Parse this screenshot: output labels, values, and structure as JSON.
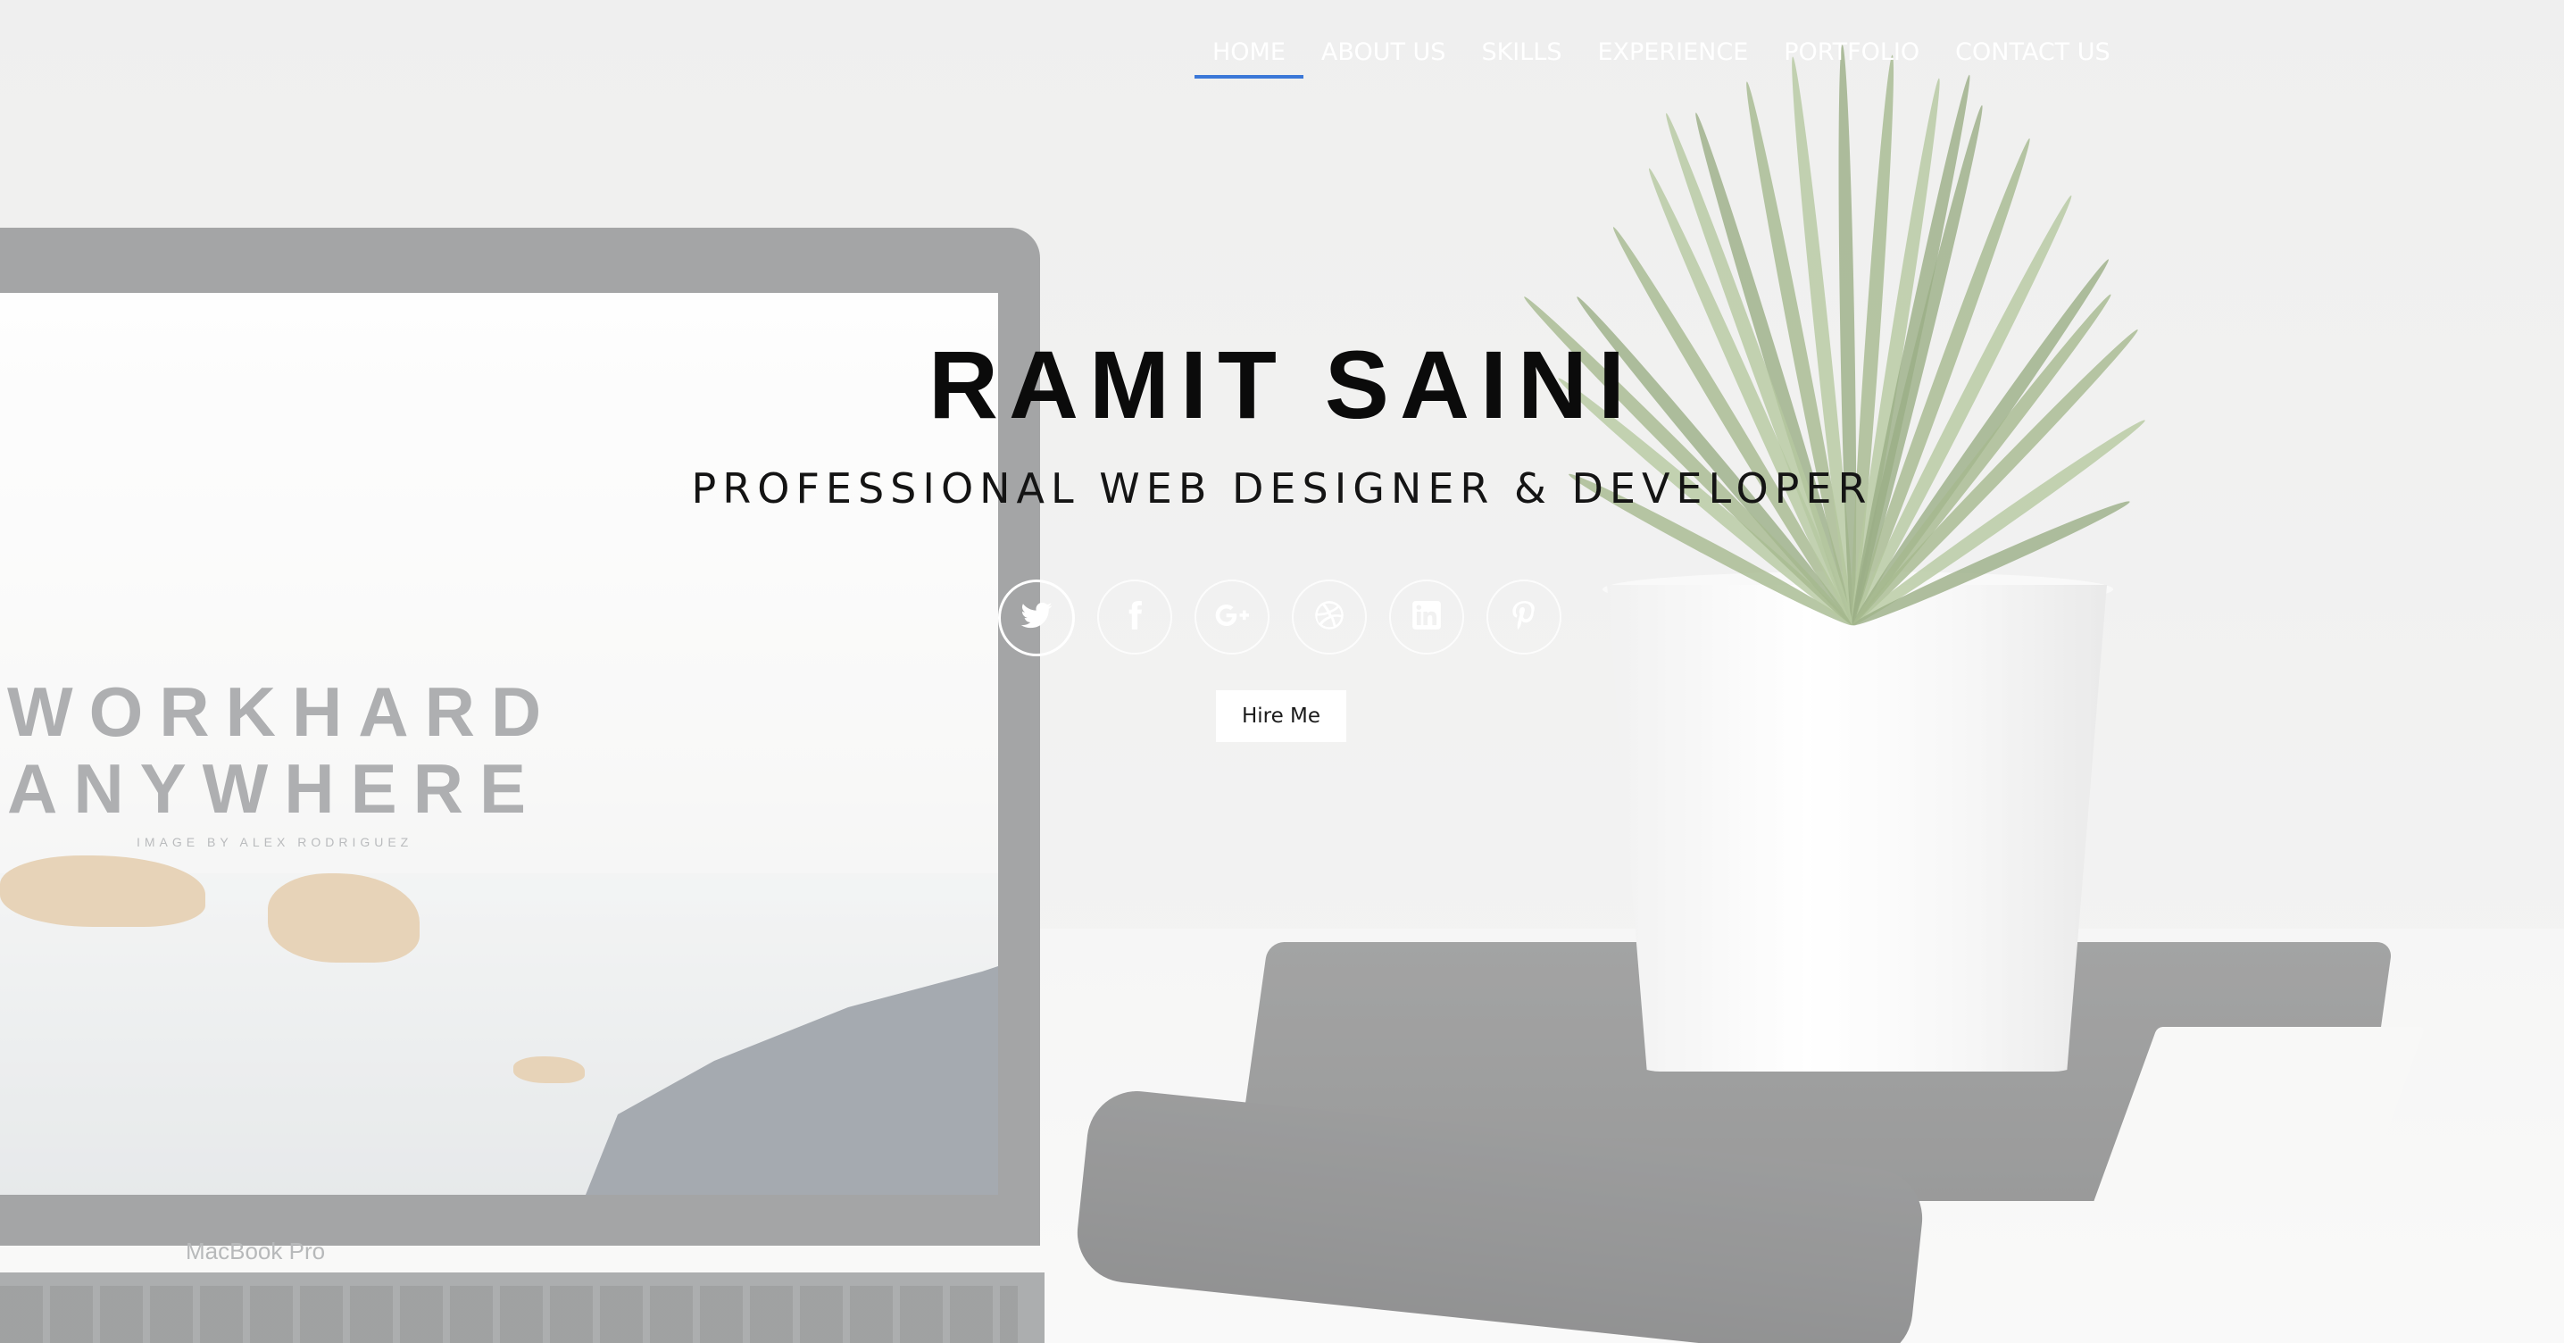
{
  "nav": {
    "items": [
      {
        "label": "HOME",
        "active": true
      },
      {
        "label": "ABOUT US",
        "active": false
      },
      {
        "label": "SKILLS",
        "active": false
      },
      {
        "label": "EXPERIENCE",
        "active": false
      },
      {
        "label": "PORTFOLIO",
        "active": false
      },
      {
        "label": "CONTACT US",
        "active": false
      }
    ],
    "active_color": "#3b78d8"
  },
  "hero": {
    "title": "RAMIT SAINI",
    "subtitle": "PROFESSIONAL WEB DESIGNER & DEVELOPER",
    "socials": [
      {
        "icon": "twitter-icon"
      },
      {
        "icon": "facebook-icon"
      },
      {
        "icon": "google-plus-icon"
      },
      {
        "icon": "dribbble-icon"
      },
      {
        "icon": "linkedin-icon"
      },
      {
        "icon": "pinterest-icon"
      }
    ],
    "cta_label": "Hire Me"
  },
  "background": {
    "screen_line1": "WORKHARD",
    "screen_line2": "ANYWHERE",
    "screen_credit": "IMAGE BY ALEX RODRIGUEZ",
    "laptop_label": "MacBook Pro"
  }
}
